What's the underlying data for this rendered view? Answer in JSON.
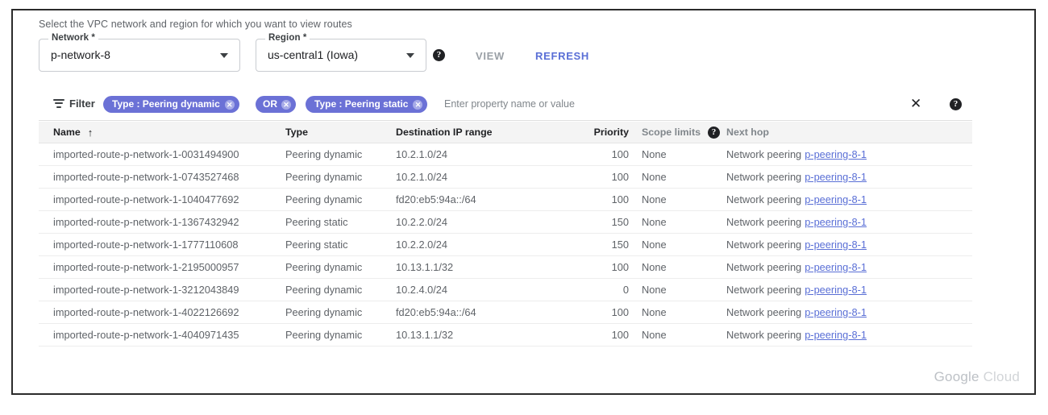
{
  "intro": "Select the VPC network and region for which you want to view routes",
  "selectors": {
    "network": {
      "legend": "Network *",
      "value": "p-network-8"
    },
    "region": {
      "legend": "Region *",
      "value": "us-central1 (Iowa)"
    },
    "help_glyph": "?"
  },
  "actions": {
    "view": "VIEW",
    "refresh": "REFRESH"
  },
  "filter": {
    "label": "Filter",
    "chips": [
      {
        "text": "Type : Peering dynamic",
        "remove": "✕"
      },
      {
        "text": "OR",
        "remove": "✕"
      },
      {
        "text": "Type : Peering static",
        "remove": "✕"
      }
    ],
    "placeholder": "Enter property name or value",
    "clear": "✕",
    "help_glyph": "?"
  },
  "table": {
    "columns": [
      {
        "key": "name",
        "label": "Name",
        "sort": "↑"
      },
      {
        "key": "type",
        "label": "Type"
      },
      {
        "key": "dest",
        "label": "Destination IP range"
      },
      {
        "key": "prio",
        "label": "Priority"
      },
      {
        "key": "scope",
        "label": "Scope limits",
        "muted": true,
        "help": "?"
      },
      {
        "key": "hop",
        "label": "Next hop",
        "muted": true
      }
    ],
    "rows": [
      {
        "name": "imported-route-p-network-1-0031494900",
        "type": "Peering dynamic",
        "dest": "10.2.1.0/24",
        "prio": "100",
        "scope": "None",
        "hop_prefix": "Network peering",
        "hop_link": "p-peering-8-1"
      },
      {
        "name": "imported-route-p-network-1-0743527468",
        "type": "Peering dynamic",
        "dest": "10.2.1.0/24",
        "prio": "100",
        "scope": "None",
        "hop_prefix": "Network peering",
        "hop_link": "p-peering-8-1"
      },
      {
        "name": "imported-route-p-network-1-1040477692",
        "type": "Peering dynamic",
        "dest": "fd20:eb5:94a::/64",
        "prio": "100",
        "scope": "None",
        "hop_prefix": "Network peering",
        "hop_link": "p-peering-8-1"
      },
      {
        "name": "imported-route-p-network-1-1367432942",
        "type": "Peering static",
        "dest": "10.2.2.0/24",
        "prio": "150",
        "scope": "None",
        "hop_prefix": "Network peering",
        "hop_link": "p-peering-8-1"
      },
      {
        "name": "imported-route-p-network-1-1777110608",
        "type": "Peering static",
        "dest": "10.2.2.0/24",
        "prio": "150",
        "scope": "None",
        "hop_prefix": "Network peering",
        "hop_link": "p-peering-8-1"
      },
      {
        "name": "imported-route-p-network-1-2195000957",
        "type": "Peering dynamic",
        "dest": "10.13.1.1/32",
        "prio": "100",
        "scope": "None",
        "hop_prefix": "Network peering",
        "hop_link": "p-peering-8-1"
      },
      {
        "name": "imported-route-p-network-1-3212043849",
        "type": "Peering dynamic",
        "dest": "10.2.4.0/24",
        "prio": "0",
        "scope": "None",
        "hop_prefix": "Network peering",
        "hop_link": "p-peering-8-1"
      },
      {
        "name": "imported-route-p-network-1-4022126692",
        "type": "Peering dynamic",
        "dest": "fd20:eb5:94a::/64",
        "prio": "100",
        "scope": "None",
        "hop_prefix": "Network peering",
        "hop_link": "p-peering-8-1"
      },
      {
        "name": "imported-route-p-network-1-4040971435",
        "type": "Peering dynamic",
        "dest": "10.13.1.1/32",
        "prio": "100",
        "scope": "None",
        "hop_prefix": "Network peering",
        "hop_link": "p-peering-8-1"
      }
    ]
  },
  "footer": {
    "brand_bold": "Google",
    "brand_light": " Cloud"
  },
  "colors": {
    "chip": "#6b71d6",
    "link": "#5a6fd6",
    "disabled": "#9aa0a6",
    "header_bg": "#f4f4f4"
  }
}
